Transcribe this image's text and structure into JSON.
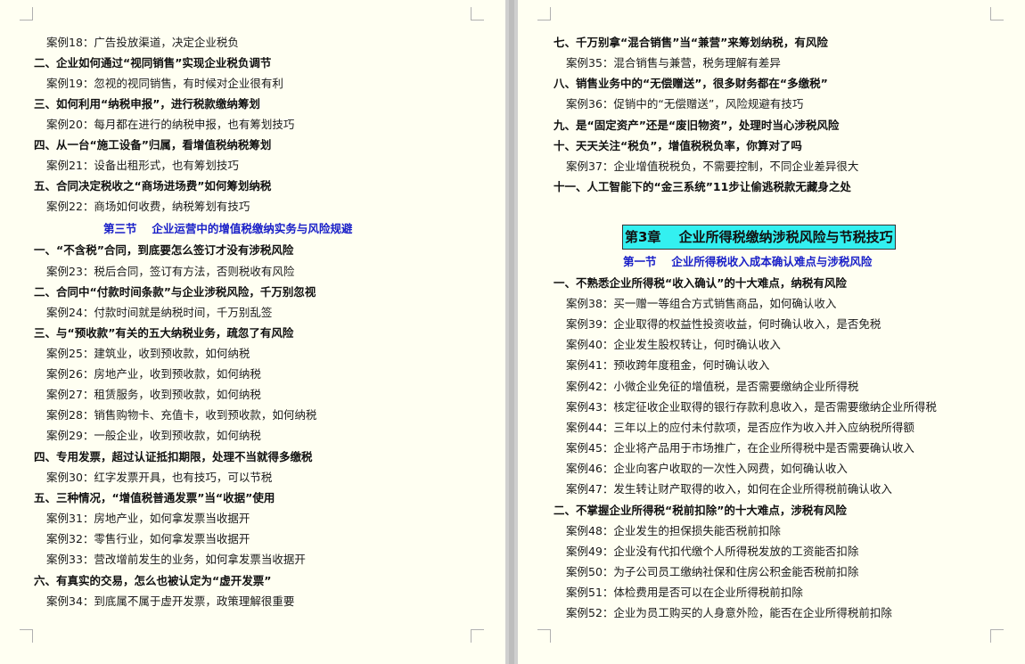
{
  "left_page": {
    "lines": [
      {
        "type": "case",
        "text": "案例18：广告投放渠道，决定企业税负"
      },
      {
        "type": "heading",
        "text": "二、企业如何通过“视同销售”实现企业税负调节"
      },
      {
        "type": "case",
        "text": "案例19：忽视的视同销售，有时候对企业很有利"
      },
      {
        "type": "heading",
        "text": "三、如何利用“纳税申报”，进行税款缴纳筹划"
      },
      {
        "type": "case",
        "text": "案例20：每月都在进行的纳税申报，也有筹划技巧"
      },
      {
        "type": "heading",
        "text": "四、从一台“施工设备”归属，看增值税纳税筹划"
      },
      {
        "type": "case",
        "text": "案例21：设备出租形式，也有筹划技巧"
      },
      {
        "type": "heading",
        "text": "五、合同决定税收之“商场进场费”如何筹划纳税"
      },
      {
        "type": "case",
        "text": "案例22：商场如何收费，纳税筹划有技巧"
      },
      {
        "type": "section",
        "text": "第三节　 企业运营中的增值税缴纳实务与风险规避"
      },
      {
        "type": "heading",
        "text": "一、“不含税”合同，到底要怎么签订才没有涉税风险"
      },
      {
        "type": "case",
        "text": "案例23：税后合同，签订有方法，否则税收有风险"
      },
      {
        "type": "heading",
        "text": "二、合同中“付款时间条款”与企业涉税风险，千万别忽视"
      },
      {
        "type": "case",
        "text": "案例24：付款时间就是纳税时间，千万别乱签"
      },
      {
        "type": "heading",
        "text": "三、与“预收款”有关的五大纳税业务，疏忽了有风险"
      },
      {
        "type": "case",
        "text": "案例25：建筑业，收到预收款，如何纳税"
      },
      {
        "type": "case",
        "text": "案例26：房地产业，收到预收款，如何纳税"
      },
      {
        "type": "case",
        "text": "案例27：租赁服务，收到预收款，如何纳税"
      },
      {
        "type": "case",
        "text": "案例28：销售购物卡、充值卡，收到预收款，如何纳税"
      },
      {
        "type": "case",
        "text": "案例29：一般企业，收到预收款，如何纳税"
      },
      {
        "type": "heading",
        "text": "四、专用发票，超过认证抵扣期限，处理不当就得多缴税"
      },
      {
        "type": "case",
        "text": "案例30：红字发票开具，也有技巧，可以节税"
      },
      {
        "type": "heading",
        "text": "五、三种情况，“增值税普通发票”当“收据”使用"
      },
      {
        "type": "case",
        "text": "案例31：房地产业，如何拿发票当收据开"
      },
      {
        "type": "case",
        "text": "案例32：零售行业，如何拿发票当收据开"
      },
      {
        "type": "case",
        "text": "案例33：营改增前发生的业务，如何拿发票当收据开"
      },
      {
        "type": "heading",
        "text": "六、有真实的交易，怎么也被认定为“虚开发票”"
      },
      {
        "type": "case",
        "text": "案例34：到底属不属于虚开发票，政策理解很重要"
      }
    ]
  },
  "right_page": {
    "lines_top": [
      {
        "type": "heading",
        "text": "七、千万别拿“混合销售”当“兼营”来筹划纳税，有风险"
      },
      {
        "type": "case",
        "text": "案例35：混合销售与兼营，税务理解有差异"
      },
      {
        "type": "heading",
        "text": "八、销售业务中的“无偿赠送”，很多财务都在“多缴税”"
      },
      {
        "type": "case",
        "text": "案例36：促销中的“无偿赠送”，风险规避有技巧"
      },
      {
        "type": "heading",
        "text": "九、是“固定资产”还是“废旧物资”，处理时当心涉税风险"
      },
      {
        "type": "heading",
        "text": "十、天天关注“税负”，增值税税负率，你算对了吗"
      },
      {
        "type": "case",
        "text": "案例37：企业增值税税负，不需要控制，不同企业差异很大"
      },
      {
        "type": "heading",
        "text": "十一、人工智能下的“金三系统”11步让偷逃税款无藏身之处"
      }
    ],
    "chapter_title": "第3章　 企业所得税缴纳涉税风险与节税技巧",
    "section_title": "第一节　 企业所得税收入成本确认难点与涉税风险",
    "lines_bottom": [
      {
        "type": "heading",
        "text": "一、不熟悉企业所得税“收入确认”的十大难点，纳税有风险"
      },
      {
        "type": "case",
        "text": "案例38：买一赠一等组合方式销售商品，如何确认收入"
      },
      {
        "type": "case",
        "text": "案例39：企业取得的权益性投资收益，何时确认收入，是否免税"
      },
      {
        "type": "case",
        "text": "案例40：企业发生股权转让，何时确认收入"
      },
      {
        "type": "case",
        "text": "案例41：预收跨年度租金，何时确认收入"
      },
      {
        "type": "case",
        "text": "案例42：小微企业免征的增值税，是否需要缴纳企业所得税"
      },
      {
        "type": "case",
        "text": "案例43：核定征收企业取得的银行存款利息收入，是否需要缴纳企业所得税"
      },
      {
        "type": "case",
        "text": "案例44：三年以上的应付未付款项，是否应作为收入并入应纳税所得额"
      },
      {
        "type": "case",
        "text": "案例45：企业将产品用于市场推广，在企业所得税中是否需要确认收入"
      },
      {
        "type": "case",
        "text": "案例46：企业向客户收取的一次性入网费，如何确认收入"
      },
      {
        "type": "case",
        "text": "案例47：发生转让财产取得的收入，如何在企业所得税前确认收入"
      },
      {
        "type": "heading",
        "text": "二、不掌握企业所得税“税前扣除”的十大难点，涉税有风险"
      },
      {
        "type": "case",
        "text": "案例48：企业发生的担保损失能否税前扣除"
      },
      {
        "type": "case",
        "text": "案例49：企业没有代扣代缴个人所得税发放的工资能否扣除"
      },
      {
        "type": "case",
        "text": "案例50：为子公司员工缴纳社保和住房公积金能否税前扣除"
      },
      {
        "type": "case",
        "text": "案例51：体检费用是否可以在企业所得税前扣除"
      },
      {
        "type": "case",
        "text": "案例52：企业为员工购买的人身意外险，能否在企业所得税前扣除"
      }
    ]
  }
}
